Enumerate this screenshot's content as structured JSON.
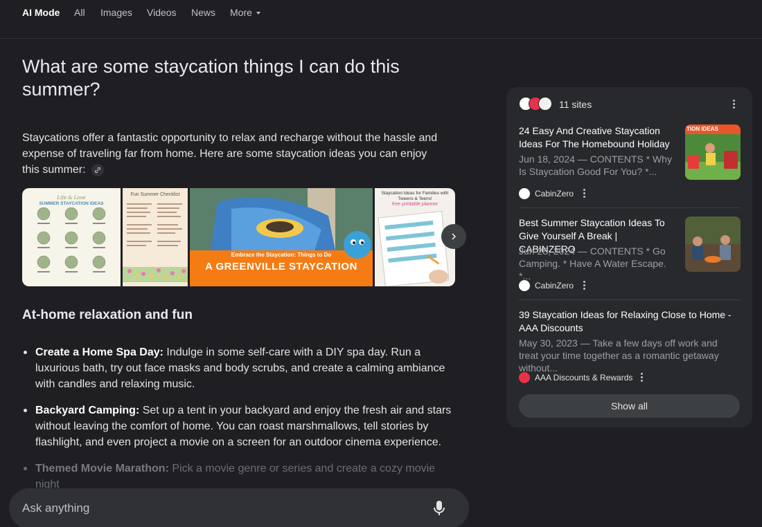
{
  "nav": {
    "tabs": [
      "AI Mode",
      "All",
      "Images",
      "Videos",
      "News",
      "More"
    ]
  },
  "main": {
    "question": "What are some staycation things I can do this summer?",
    "intro": "Staycations offer a fantastic opportunity to relax and recharge without the hassle and expense of traveling far from home. Here are some staycation ideas you can enjoy this summer:",
    "images": [
      {
        "title": "Life & Love",
        "subtitle": "SUMMER STAYCATION IDEAS"
      },
      {
        "title": "Fun Summer Checklist"
      },
      {
        "title": "Embrace the Staycation: Things to Do",
        "subtitle": "A GREENVILLE STAYCATION"
      },
      {
        "title": "Staycation Ideas for Families with Tweens & Teens!",
        "subtitle": "free printable planner"
      }
    ],
    "section_title": "At-home relaxation and fun",
    "bullets": [
      {
        "label": "Create a Home Spa Day:",
        "text": " Indulge in some self-care with a DIY spa day. Run a luxurious bath, try out face masks and body scrubs, and create a calming ambiance with candles and relaxing music."
      },
      {
        "label": "Backyard Camping:",
        "text": " Set up a tent in your backyard and enjoy the fresh air and stars without leaving the comfort of home. You can roast marshmallows, tell stories by flashlight, and even project a movie on a screen for an outdoor cinema experience."
      },
      {
        "label": "Themed Movie Marathon:",
        "text": " Pick a movie genre or series and create a cozy movie night"
      }
    ]
  },
  "askbar": {
    "placeholder": "Ask anything",
    "icon": "mic-icon"
  },
  "sources": {
    "count_label": "11 sites",
    "items": [
      {
        "title": "24 Easy And Creative Staycation Ideas For The Homebound Holiday",
        "snippet": "Jun 18, 2024 — CONTENTS * Why Is Staycation Good For You? *...",
        "site": "CabinZero",
        "thumb_label": "TION IDEAS"
      },
      {
        "title": "Best Summer Staycation Ideas To Give Yourself A Break | CABINZERO",
        "snippet": "Jun 28, 2024 — CONTENTS * Go Camping. * Have A Water Escape. *...",
        "site": "CabinZero"
      },
      {
        "title": "39 Staycation Ideas for Relaxing Close to Home - AAA Discounts",
        "snippet": "May 30, 2023 — Take a few days off work and treat your time together as a romantic getaway without...",
        "site": "AAA Discounts & Rewards"
      }
    ],
    "show_all": "Show all"
  },
  "colors": {
    "background": "#1f1f23",
    "panel": "#28292c",
    "accent_orange": "#f57c14",
    "pill": "#3c4043"
  }
}
